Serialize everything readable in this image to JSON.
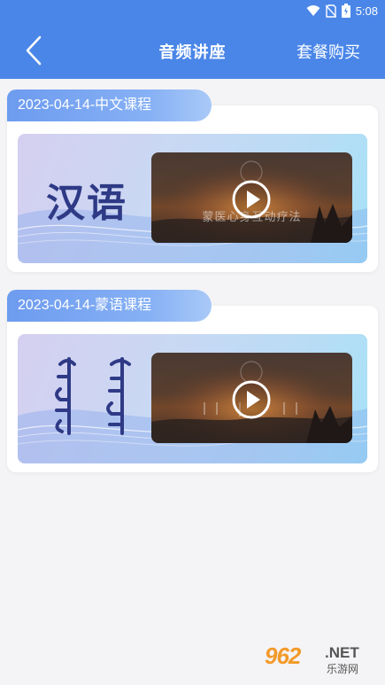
{
  "status_bar": {
    "time": "5:08"
  },
  "nav": {
    "title": "音频讲座",
    "action_label": "套餐购买"
  },
  "courses": [
    {
      "date_label": "2023-04-14-中文课程",
      "language_label": "汉语",
      "thumb_caption": "蒙医心身互动疗法"
    },
    {
      "date_label": "2023-04-14-蒙语课程",
      "language_label": "ᠮᠣᠩᠭᠣᠯ",
      "thumb_caption": ""
    }
  ],
  "watermark": {
    "number": "962",
    "domain": ".NET",
    "site_name": "乐游网"
  },
  "colors": {
    "header_blue": "#4a86e8",
    "date_tab": "#6d9bef",
    "lang_text": "#2f3a86",
    "background": "#f4f4f6"
  }
}
